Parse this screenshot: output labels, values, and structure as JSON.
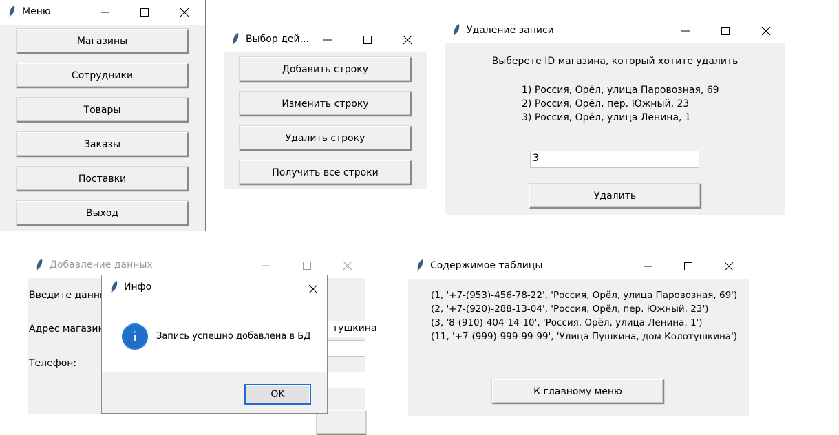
{
  "menu_window": {
    "title": "Меню",
    "buttons": [
      "Магазины",
      "Сотрудники",
      "Товары",
      "Заказы",
      "Поставки",
      "Выход"
    ]
  },
  "action_window": {
    "title": "Выбор дей...",
    "buttons": [
      "Добавить строку",
      "Изменить строку",
      "Удалить строку",
      "Получить все строки"
    ]
  },
  "delete_window": {
    "title": "Удаление записи",
    "prompt": "Выберете ID магазина, который хотите удалить",
    "options": [
      "1) Россия, Орёл, улица Паровозная, 69",
      "2) Россия, Орёл, пер. Южный, 23",
      "3) Россия, Орёл, улица Ленина, 1"
    ],
    "input_value": "3",
    "delete_label": "Удалить"
  },
  "add_window": {
    "title": "Добавление данных",
    "label_intro": "Введите данны",
    "label_address": "Адрес магазина",
    "label_phone": "Телефон:",
    "address_value_fragment": "тушкина"
  },
  "info_dialog": {
    "title": "Инфо",
    "message": "Запись успешно добавлена в БД",
    "ok_label": "OK",
    "icon_letter": "i"
  },
  "table_window": {
    "title": "Содержимое таблицы",
    "rows": [
      "(1, '+7-(953)-456-78-22', 'Россия, Орёл, улица Паровозная, 69')",
      "(2, '+7-(920)-288-13-04', 'Россия, Орёл, пер. Южный, 23')",
      "(3, '8-(910)-404-14-10', 'Россия, Орёл, улица Ленина, 1')",
      "(11, '+7-(999)-999-99-99', 'Улица Пушкина, дом Колотушкина')"
    ],
    "back_label": "К главному меню"
  },
  "colors": {
    "info_icon": "#1f6fc6",
    "ok_border": "#1c6ed6",
    "window_bg": "#f0f0f0"
  }
}
